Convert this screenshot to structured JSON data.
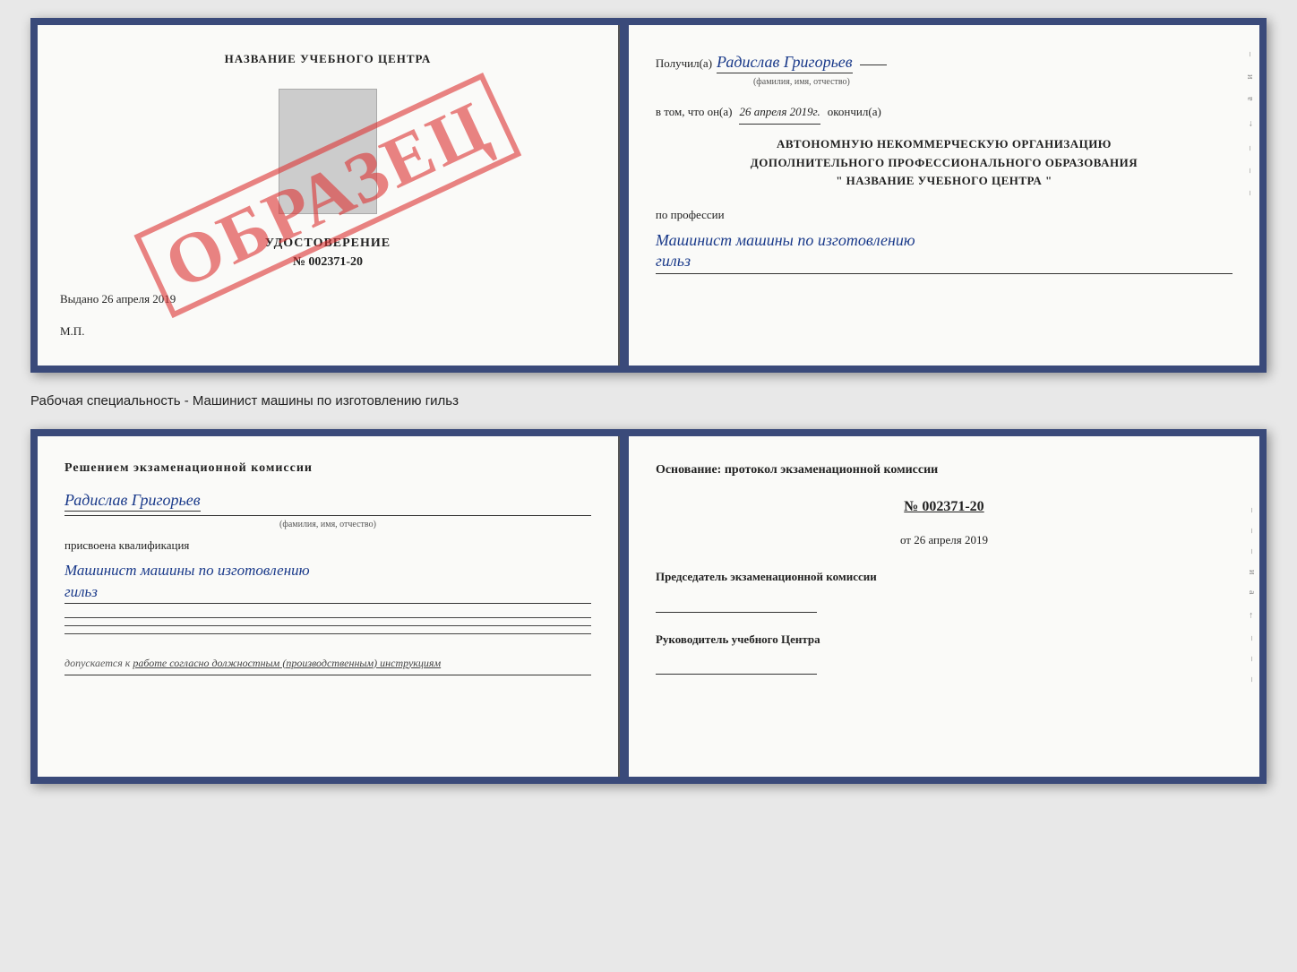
{
  "topDoc": {
    "left": {
      "centerName": "НАЗВАНИЕ УЧЕБНОГО ЦЕНТРА",
      "udostoverenie": "УДОСТОВЕРЕНИЕ",
      "number": "№ 002371-20",
      "vydano": "Выдано",
      "vydanoDate": "26 апреля 2019",
      "mp": "М.П.",
      "stamp": "ОБРАЗЕЦ"
    },
    "right": {
      "poluchil": "Получил(а)",
      "receiverName": "Радислав Григорьев",
      "fioLabel": "(фамилия, имя, отчество)",
      "vtomChto": "в том, что он(а)",
      "date": "26 апреля 2019г.",
      "okonchil": "окончил(а)",
      "orgLine1": "АВТОНОМНУЮ НЕКОММЕРЧЕСКУЮ ОРГАНИЗАЦИЮ",
      "orgLine2": "ДОПОЛНИТЕЛЬНОГО ПРОФЕССИОНАЛЬНОГО ОБРАЗОВАНИЯ",
      "orgLine3": "\"  НАЗВАНИЕ УЧЕБНОГО ЦЕНТРА  \"",
      "poprofessii": "по профессии",
      "profName1": "Машинист машины по изготовлению",
      "profName2": "гильз"
    }
  },
  "separatorLabel": "Рабочая специальность - Машинист машины по изготовлению гильз",
  "bottomDoc": {
    "left": {
      "reshenieTitle": "Решением  экзаменационной  комиссии",
      "personName": "Радислав Григорьев",
      "fioLabel": "(фамилия, имя, отчество)",
      "prisvoyena": "присвоена квалификация",
      "qualName1": "Машинист  машины  по  изготовлению",
      "qualName2": "гильз",
      "dopuskaetsya": "допускается к",
      "dopuskaetsyaText": "работе согласно должностным (производственным) инструкциям"
    },
    "right": {
      "osnovanieTitle": "Основание: протокол экзаменационной  комиссии",
      "protocolNumber": "№  002371-20",
      "otLabel": "от",
      "otDate": "26 апреля 2019",
      "predsedatelLabel": "Председатель экзаменационной комиссии",
      "rukovoditelLabel": "Руководитель учебного Центра"
    }
  }
}
